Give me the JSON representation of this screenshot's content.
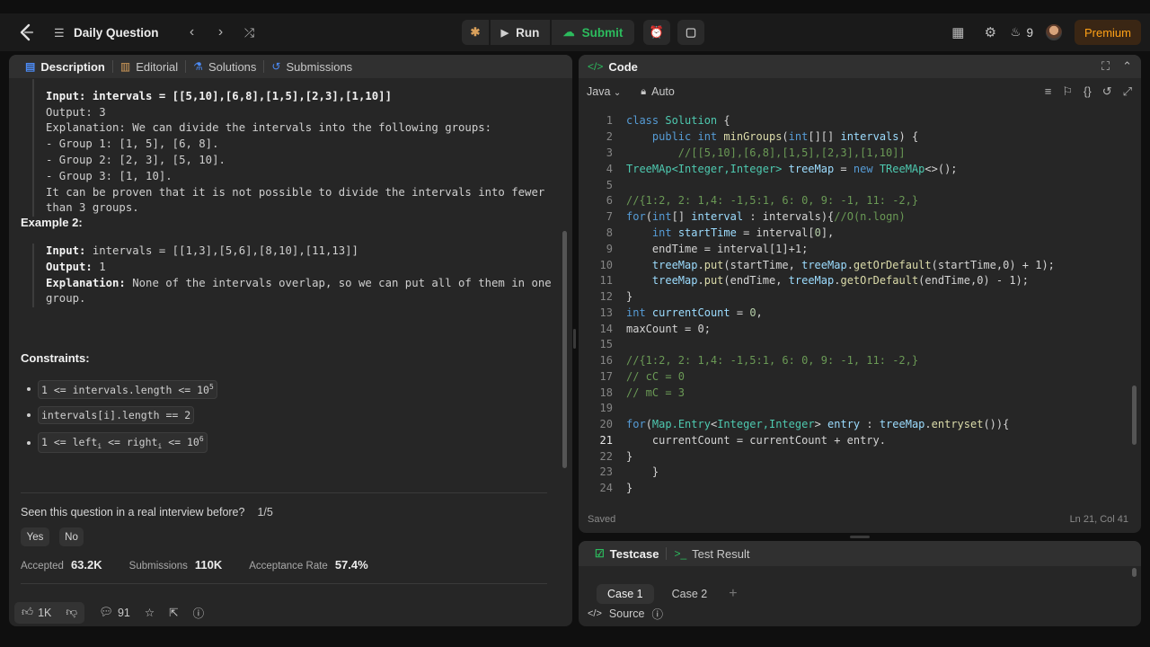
{
  "nav": {
    "title": "Daily Question",
    "streak_count": "9",
    "premium_label": "Premium",
    "run_label": "Run",
    "submit_label": "Submit"
  },
  "left_tabs": {
    "description": "Description",
    "editorial": "Editorial",
    "solutions": "Solutions",
    "submissions": "Submissions"
  },
  "description": {
    "example1_lines": [
      "Input: intervals = [[5,10],[6,8],[1,5],[2,3],[1,10]]",
      "Output: 3",
      "Explanation: We can divide the intervals into the following groups:",
      "- Group 1: [1, 5], [6, 8].",
      "- Group 2: [2, 3], [5, 10].",
      "- Group 3: [1, 10].",
      "It can be proven that it is not possible to divide the intervals into fewer",
      "than 3 groups."
    ],
    "example2_title": "Example 2:",
    "example2": {
      "input_label": "Input:",
      "input_value": "intervals = [[1,3],[5,6],[8,10],[11,13]]",
      "output_label": "Output:",
      "output_value": "1",
      "explanation_label": "Explanation:",
      "explanation_line1": "None of the intervals overlap, so we can put all of them in one",
      "explanation_line2": "group."
    },
    "constraints_title": "Constraints:",
    "constraints": [
      {
        "text": "1 <= intervals.length <= 10",
        "sup": "5",
        "sub": ""
      },
      {
        "text": "intervals[i].length == 2",
        "sup": "",
        "sub": ""
      },
      {
        "text": "1 <= left",
        "sub1": "i",
        "mid": " <= right",
        "sub2": "i",
        "end": " <= 10",
        "sup": "6"
      }
    ],
    "seen_question": "Seen this question in a real interview before?",
    "seen_fraction": "1/5",
    "yes_label": "Yes",
    "no_label": "No",
    "accepted_label": "Accepted",
    "accepted_value": "63.2K",
    "submissions_label": "Submissions",
    "submissions_value": "110K",
    "acceptance_label": "Acceptance Rate",
    "acceptance_value": "57.4%",
    "likes": "1K",
    "comments": "91"
  },
  "code": {
    "title": "Code",
    "language": "Java",
    "mode": "Auto",
    "saved_label": "Saved",
    "cursor_pos": "Ln 21, Col 41",
    "line_numbers": [
      "1",
      "2",
      "3",
      "4",
      "5",
      "6",
      "7",
      "8",
      "9",
      "10",
      "11",
      "12",
      "13",
      "14",
      "15",
      "16",
      "17",
      "18",
      "19",
      "20",
      "21",
      "22",
      "23",
      "24"
    ]
  },
  "testcase": {
    "tab_testcase": "Testcase",
    "tab_result": "Test Result",
    "case1": "Case 1",
    "case2": "Case 2",
    "source_label": "Source"
  },
  "colors": {
    "accent_green": "#2cbb5d",
    "premium_orange": "#ffa116",
    "panel_bg": "#262626"
  },
  "icons": [
    "logo-icon",
    "list-icon",
    "chevron-left-icon",
    "chevron-right-icon",
    "shuffle-icon",
    "bug-icon",
    "play-icon",
    "cloud-upload-icon",
    "alarm-icon",
    "notes-icon",
    "grid-icon",
    "gear-icon",
    "fire-icon",
    "avatar",
    "fullscreen-icon",
    "collapse-icon",
    "lock-icon",
    "format-icon",
    "bookmark-icon",
    "braces-icon",
    "reset-icon",
    "expand-icon",
    "thumbs-up-icon",
    "thumbs-down-icon",
    "comment-icon",
    "star-icon",
    "share-icon",
    "help-icon",
    "checkbox-icon",
    "terminal-icon"
  ]
}
